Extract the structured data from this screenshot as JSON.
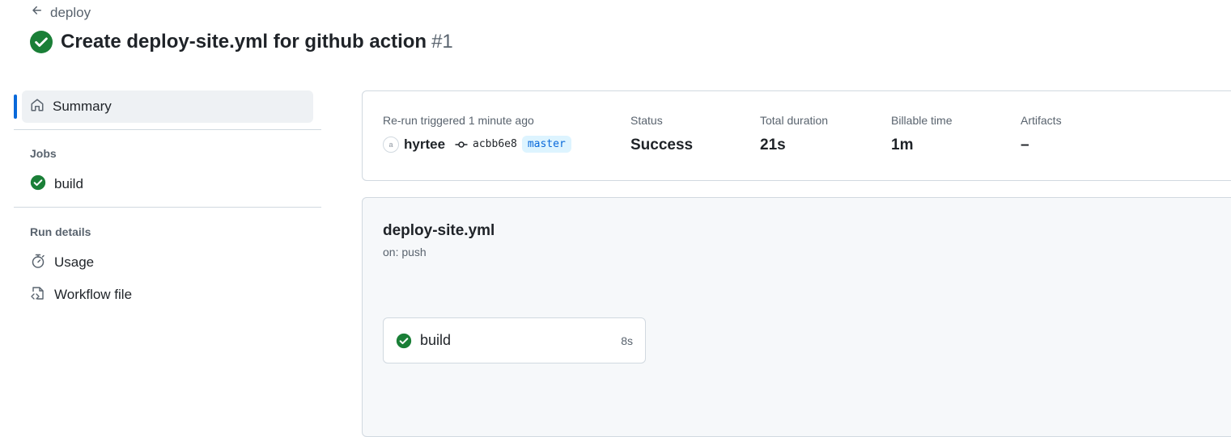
{
  "breadcrumb": {
    "back_label": "deploy"
  },
  "run": {
    "title": "Create deploy-site.yml for github action",
    "number": "#1"
  },
  "sidebar": {
    "summary_label": "Summary",
    "jobs_title": "Jobs",
    "jobs": [
      {
        "label": "build"
      }
    ],
    "run_details_title": "Run details",
    "details": [
      {
        "label": "Usage"
      },
      {
        "label": "Workflow file"
      }
    ]
  },
  "summary": {
    "trigger_label": "Re-run triggered 1 minute ago",
    "actor": "hyrtee",
    "avatar_letter": "a",
    "commit_sha": "acbb6e8",
    "branch": "master",
    "status_label": "Status",
    "status_value": "Success",
    "duration_label": "Total duration",
    "duration_value": "21s",
    "billable_label": "Billable time",
    "billable_value": "1m",
    "artifacts_label": "Artifacts",
    "artifacts_value": "–"
  },
  "workflow": {
    "file_name": "deploy-site.yml",
    "trigger": "on: push",
    "jobs": [
      {
        "name": "build",
        "duration": "8s"
      }
    ]
  },
  "colors": {
    "success": "#1a7f37",
    "accent": "#0969da",
    "muted": "#59636e"
  },
  "icons": [
    "arrow-left-icon",
    "check-circle-fill-icon",
    "home-icon",
    "stopwatch-icon",
    "file-code-icon",
    "git-commit-icon"
  ]
}
